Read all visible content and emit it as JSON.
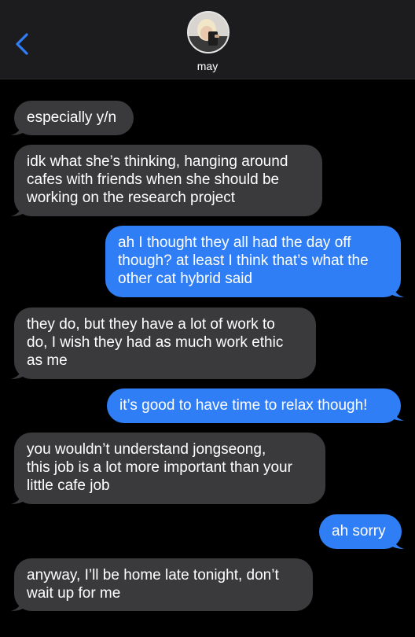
{
  "header": {
    "contact_name": "may",
    "back_icon": "chevron-left-icon",
    "accent_color": "#2f7ef6"
  },
  "messages": [
    {
      "direction": "incoming",
      "text": "especially y/n"
    },
    {
      "direction": "incoming",
      "text": "idk what she’s thinking, hanging around\ncafes with friends when she should be\nworking on the research project"
    },
    {
      "direction": "outgoing",
      "text": "ah I thought they all had the day off\nthough? at least I think that’s what the\nother cat hybrid said"
    },
    {
      "direction": "incoming",
      "text": "they do, but they have a lot of work to\ndo, I wish they had as much work ethic\nas me"
    },
    {
      "direction": "outgoing",
      "text": "it’s good to have time to relax though!"
    },
    {
      "direction": "incoming",
      "text": "you wouldn’t understand jongseong,\nthis job is a lot more important than your\nlittle cafe job"
    },
    {
      "direction": "outgoing",
      "text": "ah sorry"
    },
    {
      "direction": "incoming",
      "text": "anyway, I’ll be home late tonight, don’t\nwait up for me"
    }
  ],
  "colors": {
    "incoming_bubble": "#3a3a3c",
    "outgoing_bubble": "#2f7ef6",
    "background": "#000000",
    "header_background": "#1c1c1e"
  }
}
